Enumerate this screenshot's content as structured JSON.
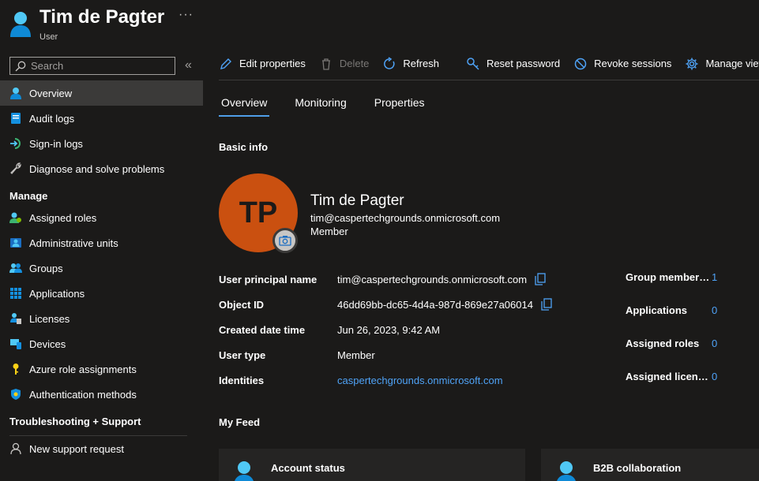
{
  "header": {
    "title": "Tim de Pagter",
    "subtitle": "User",
    "more": "···"
  },
  "sidebar": {
    "search_placeholder": "Search",
    "collapse": "«",
    "items": [
      {
        "label": "Overview",
        "icon": "user-icon",
        "active": true
      },
      {
        "label": "Audit logs",
        "icon": "audit-log-icon"
      },
      {
        "label": "Sign-in logs",
        "icon": "sign-in-icon"
      },
      {
        "label": "Diagnose and solve problems",
        "icon": "wrench-icon"
      }
    ],
    "manage_heading": "Manage",
    "manage_items": [
      {
        "label": "Assigned roles",
        "icon": "roles-icon"
      },
      {
        "label": "Administrative units",
        "icon": "admin-units-icon"
      },
      {
        "label": "Groups",
        "icon": "groups-icon"
      },
      {
        "label": "Applications",
        "icon": "applications-icon"
      },
      {
        "label": "Licenses",
        "icon": "licenses-icon"
      },
      {
        "label": "Devices",
        "icon": "devices-icon"
      },
      {
        "label": "Azure role assignments",
        "icon": "key-icon"
      },
      {
        "label": "Authentication methods",
        "icon": "shield-icon"
      }
    ],
    "support_heading": "Troubleshooting + Support",
    "support_items": [
      {
        "label": "New support request",
        "icon": "support-icon"
      }
    ]
  },
  "toolbar": {
    "edit": "Edit properties",
    "delete": "Delete",
    "refresh": "Refresh",
    "reset": "Reset password",
    "revoke": "Revoke sessions",
    "manage_view": "Manage view"
  },
  "tabs": [
    "Overview",
    "Monitoring",
    "Properties"
  ],
  "basic_info": {
    "heading": "Basic info",
    "initials": "TP",
    "name": "Tim de Pagter",
    "email": "tim@caspertechgrounds.onmicrosoft.com",
    "member": "Member",
    "properties": [
      {
        "label": "User principal name",
        "value": "tim@caspertechgrounds.onmicrosoft.com",
        "copy": true
      },
      {
        "label": "Object ID",
        "value": "46dd69bb-dc65-4d4a-987d-869e27a06014",
        "copy": true
      },
      {
        "label": "Created date time",
        "value": "Jun 26, 2023, 9:42 AM"
      },
      {
        "label": "User type",
        "value": "Member"
      },
      {
        "label": "Identities",
        "value": "caspertechgrounds.onmicrosoft.com",
        "link": true
      }
    ],
    "stats": [
      {
        "label": "Group memberships",
        "value": "1"
      },
      {
        "label": "Applications",
        "value": "0"
      },
      {
        "label": "Assigned roles",
        "value": "0"
      },
      {
        "label": "Assigned licenses",
        "value": "0"
      }
    ]
  },
  "feed": {
    "heading": "My Feed",
    "cards": [
      {
        "title": "Account status"
      },
      {
        "title": "B2B collaboration"
      }
    ]
  },
  "colors": {
    "accent": "#4fa3f7",
    "avatar": "#ca5010",
    "background": "#1b1a19",
    "active_nav": "#3b3a39"
  }
}
